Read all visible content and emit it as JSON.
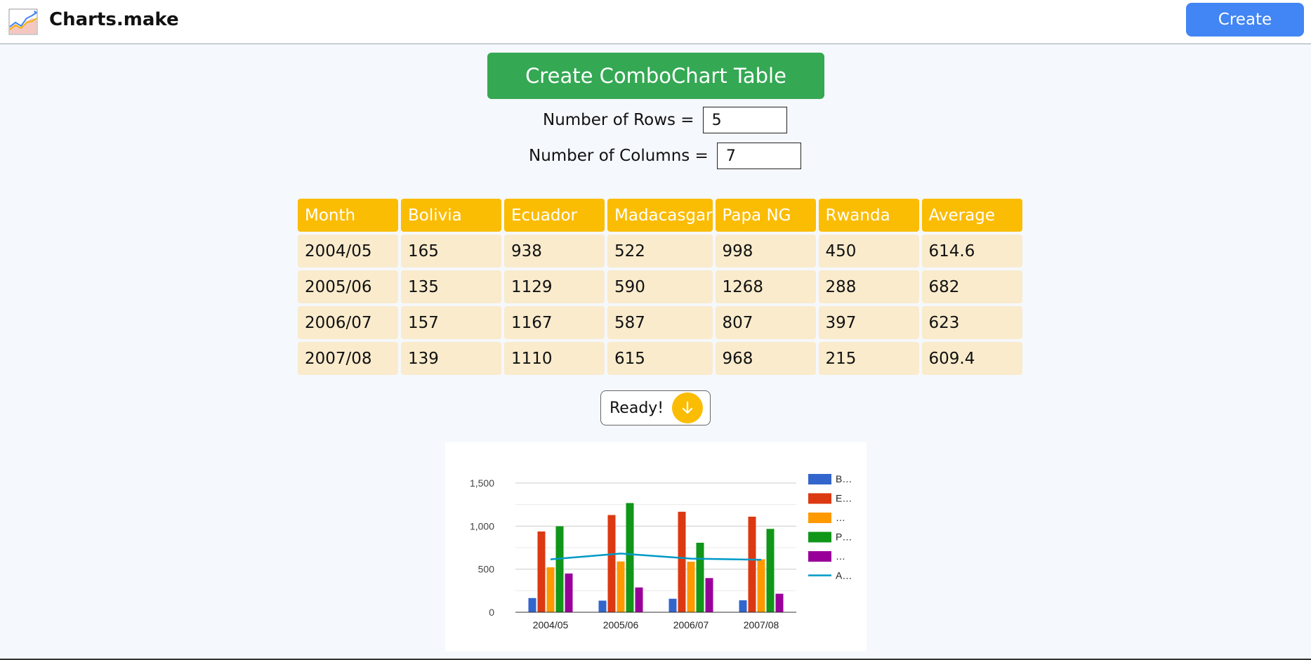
{
  "header": {
    "brand": "Charts.make",
    "create_label": "Create"
  },
  "form": {
    "create_table_label": "Create ComboChart Table",
    "rows_label": "Number of Rows =",
    "rows_value": "5",
    "columns_label": "Number of Columns =",
    "columns_value": "7"
  },
  "table": {
    "headers": [
      "Month",
      "Bolivia",
      "Ecuador",
      "Madacasgar",
      "Papa NG",
      "Rwanda",
      "Average"
    ],
    "rows": [
      [
        "2004/05",
        "165",
        "938",
        "522",
        "998",
        "450",
        "614.6"
      ],
      [
        "2005/06",
        "135",
        "1129",
        "590",
        "1268",
        "288",
        "682"
      ],
      [
        "2006/07",
        "157",
        "1167",
        "587",
        "807",
        "397",
        "623"
      ],
      [
        "2007/08",
        "139",
        "1110",
        "615",
        "968",
        "215",
        "609.4"
      ]
    ]
  },
  "ready": {
    "label": "Ready!",
    "icon": "arrow-down-icon"
  },
  "colors": {
    "header_bg": "#ffffff",
    "create_button": "#4285f4",
    "combo_button": "#34a853",
    "table_header": "#fbbc04",
    "table_cell": "#f9ebcc",
    "ready_circle": "#fbbc04"
  },
  "chart_data": {
    "type": "bar",
    "combo_line_series": "A…",
    "categories": [
      "2004/05",
      "2005/06",
      "2006/07",
      "2007/08"
    ],
    "ylim": [
      0,
      1500
    ],
    "yticks": [
      "0",
      "500",
      "1,000",
      "1,500"
    ],
    "grid": true,
    "legend_position": "right",
    "series": [
      {
        "name": "B…",
        "kind": "bar",
        "color": "#3366cc",
        "values": [
          165,
          135,
          157,
          139
        ]
      },
      {
        "name": "E…",
        "kind": "bar",
        "color": "#dc3912",
        "values": [
          938,
          1129,
          1167,
          1110
        ]
      },
      {
        "name": "…",
        "kind": "bar",
        "color": "#ff9900",
        "values": [
          522,
          590,
          587,
          615
        ]
      },
      {
        "name": "P…",
        "kind": "bar",
        "color": "#109618",
        "values": [
          998,
          1268,
          807,
          968
        ]
      },
      {
        "name": "…",
        "kind": "bar",
        "color": "#990099",
        "values": [
          450,
          288,
          397,
          215
        ]
      },
      {
        "name": "A…",
        "kind": "line",
        "color": "#0099c6",
        "values": [
          614.6,
          682,
          623,
          609.4
        ]
      }
    ]
  }
}
